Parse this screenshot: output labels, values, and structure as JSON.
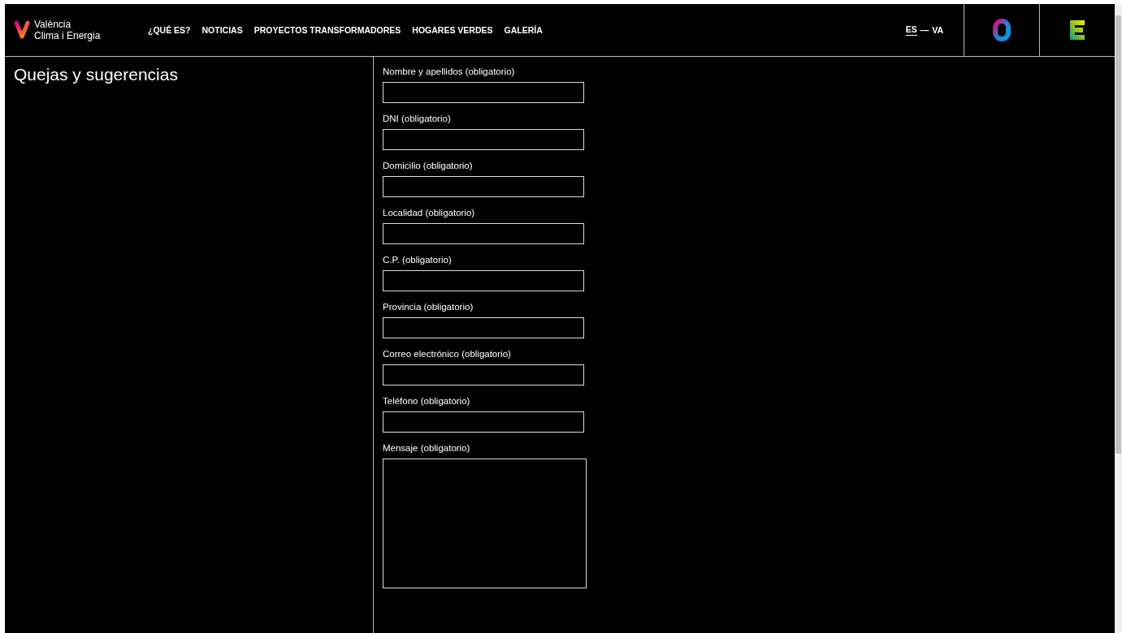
{
  "header": {
    "logo_text": [
      "València",
      "Clima i Energia"
    ],
    "nav": [
      {
        "label": "¿QUÉ ES?"
      },
      {
        "label": "NOTICIAS"
      },
      {
        "label": "PROYECTOS TRANSFORMADORES"
      },
      {
        "label": "HOGARES VERDES"
      },
      {
        "label": "GALERÍA"
      }
    ],
    "languages": [
      {
        "label": "ES",
        "selected": true
      },
      {
        "label": "VA",
        "selected": false
      }
    ],
    "language_separator": "—"
  },
  "page_title": "Quejas y sugerencias",
  "form": {
    "fields": [
      {
        "label": "Nombre y apellidos (obligatorio)",
        "kind": "text"
      },
      {
        "label": "DNI (obligatorio)",
        "kind": "text"
      },
      {
        "label": "Domicilio (obligatorio)",
        "kind": "text"
      },
      {
        "label": "Localidad (obligatorio)",
        "kind": "text"
      },
      {
        "label": "C.P. (obligatorio)",
        "kind": "text"
      },
      {
        "label": "Provincia (obligatorio)",
        "kind": "text"
      },
      {
        "label": "Correo electrónico (obligatorio)",
        "kind": "text"
      },
      {
        "label": "Teléfono (obligatorio)",
        "kind": "text"
      },
      {
        "label": "Mensaje (obligatorio)",
        "kind": "textarea"
      }
    ]
  }
}
